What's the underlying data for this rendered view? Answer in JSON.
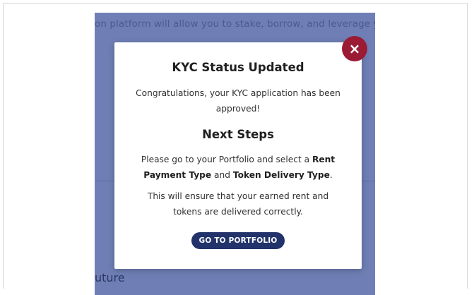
{
  "background": {
    "top_text": "on platform will allow you to stake, borrow, and leverage y",
    "bottom_text": "uture"
  },
  "modal": {
    "close_icon": "×",
    "title": "KYC Status Updated",
    "message": "Congratulations, your KYC application has been approved!",
    "subtitle": "Next Steps",
    "instructions": {
      "part1": "Please go to your Portfolio and select a ",
      "rent_payment_type": "Rent Payment Type",
      "part2": " and ",
      "token_delivery_type": "Token Delivery Type",
      "part3": "."
    },
    "note": "This will ensure that your earned rent and tokens are delivered correctly.",
    "cta_label": "GO TO PORTFOLIO"
  },
  "colors": {
    "backdrop": "#6f7fb5",
    "close_button": "#9b1b34",
    "cta_button": "#22336b"
  }
}
